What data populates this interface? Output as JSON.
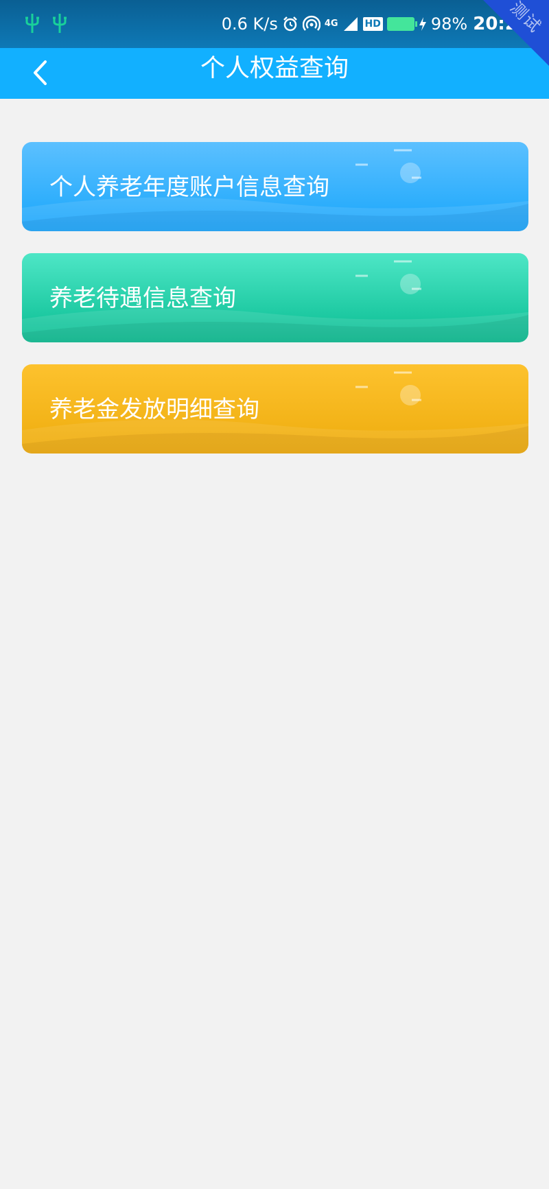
{
  "status_bar": {
    "left_icons": [
      "usb-icon",
      "usb-icon"
    ],
    "network_speed": "0.6 K/s",
    "network_label": "4G",
    "hd_label": "HD",
    "battery_percent": "98%",
    "battery_level": 0.98,
    "time": "20:29",
    "corner_label": "测试",
    "icons": [
      "alarm-icon",
      "hotspot-icon",
      "mobile-data-icon",
      "signal-icon",
      "hd-icon",
      "battery-icon",
      "charging-icon"
    ]
  },
  "header": {
    "back_icon": "chevron-left-icon",
    "title": "个人权益查询"
  },
  "cards": [
    {
      "label": "个人养老年度账户信息查询",
      "color_top": "#5cc0ff",
      "color_bottom": "#19a6fb"
    },
    {
      "label": "养老待遇信息查询",
      "color_top": "#4ee6c6",
      "color_bottom": "#08bd92"
    },
    {
      "label": "养老金发放明细查询",
      "color_top": "#fdc22e",
      "color_bottom": "#eeac0d"
    }
  ],
  "colors": {
    "status_bar": "#0e79b6",
    "nav_bar": "#12b0ff",
    "background": "#f2f2f2"
  }
}
